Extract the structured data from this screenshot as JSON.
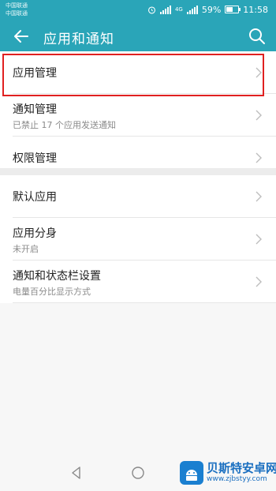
{
  "status_bar": {
    "carrier_1": "中国联通",
    "carrier_2": "中国联通",
    "network": "4G",
    "battery": "59%",
    "battery_level": 0.59,
    "time": "11:58"
  },
  "app_bar": {
    "title": "应用和通知"
  },
  "section_1": [
    {
      "title": "应用管理",
      "subtitle": ""
    },
    {
      "title": "通知管理",
      "subtitle": "已禁止 17 个应用发送通知"
    },
    {
      "title": "权限管理",
      "subtitle": ""
    }
  ],
  "section_2": [
    {
      "title": "默认应用",
      "subtitle": ""
    },
    {
      "title": "应用分身",
      "subtitle": "未开启"
    },
    {
      "title": "通知和状态栏设置",
      "subtitle": "电量百分比显示方式"
    }
  ],
  "watermark": {
    "name": "贝斯特安卓网",
    "url": "www.zjbstyy.com"
  },
  "colors": {
    "accent": "#2aa5b8",
    "highlight": "#e02020"
  }
}
